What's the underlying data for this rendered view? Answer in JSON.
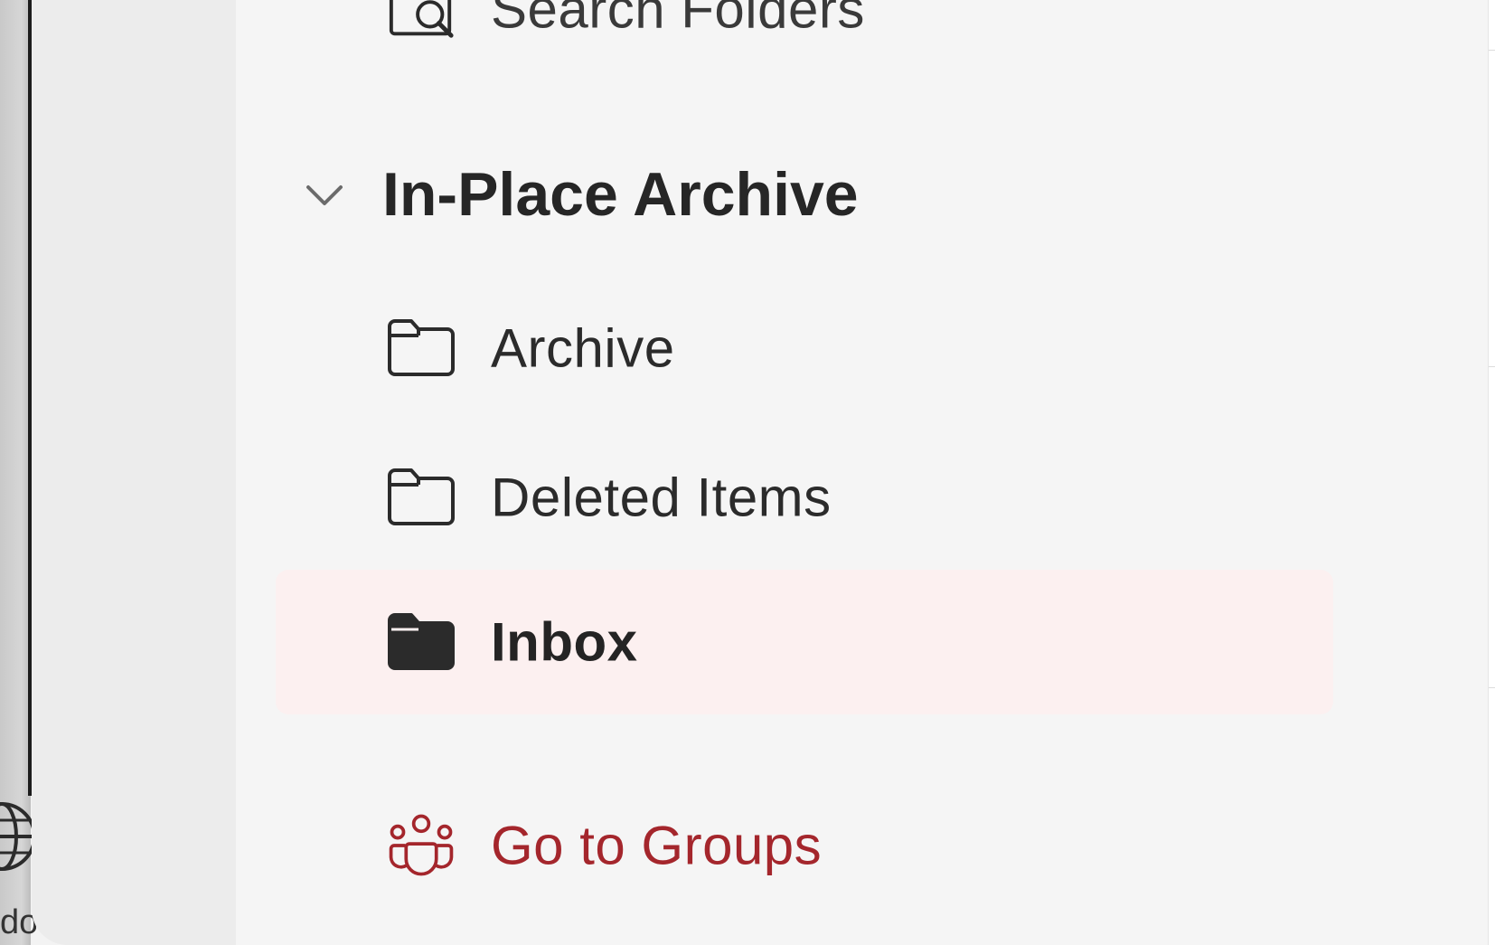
{
  "folder_pane": {
    "search_folders_label": "Search Folders",
    "section": {
      "title": "In-Place Archive",
      "expanded": true
    },
    "folders": [
      {
        "label": "Archive",
        "icon": "folder-icon",
        "selected": false
      },
      {
        "label": "Deleted Items",
        "icon": "folder-icon",
        "selected": false
      },
      {
        "label": "Inbox",
        "icon": "folder-filled-icon",
        "selected": true
      }
    ],
    "go_to_groups_label": "Go to Groups"
  },
  "desktop": {
    "corner_text": "do"
  },
  "colors": {
    "pane_background": "#f5f5f5",
    "rail_background": "#ececec",
    "selected_background": "#fcf0f0",
    "accent": "#a4262c",
    "text": "#2b2b2b"
  }
}
